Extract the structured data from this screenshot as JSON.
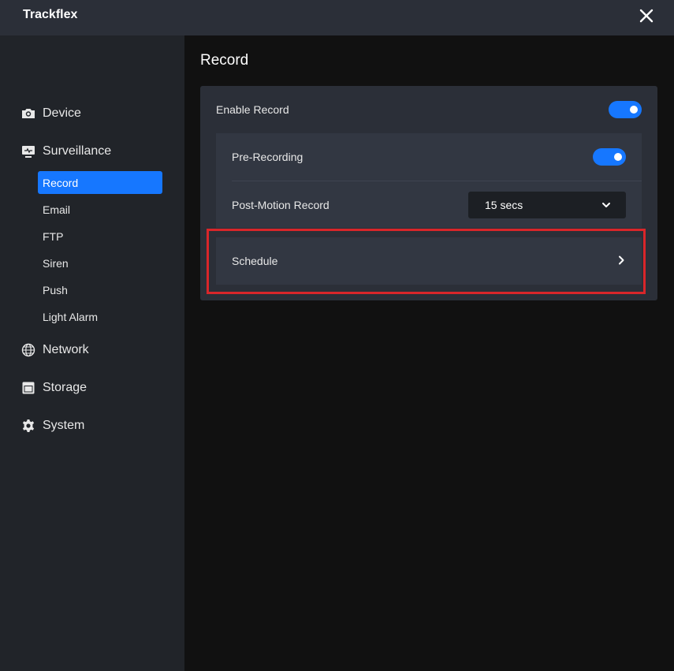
{
  "app": {
    "title": "Trackflex"
  },
  "window": {
    "close_icon": "close-icon"
  },
  "sidebar": {
    "groups": [
      {
        "label": "Device",
        "icon": "camera-icon"
      },
      {
        "label": "Surveillance",
        "icon": "monitor-icon"
      },
      {
        "label": "Network",
        "icon": "globe-icon"
      },
      {
        "label": "Storage",
        "icon": "storage-icon"
      },
      {
        "label": "System",
        "icon": "gear-icon"
      }
    ],
    "surveillance_items": [
      {
        "label": "Record",
        "active": true
      },
      {
        "label": "Email",
        "active": false
      },
      {
        "label": "FTP",
        "active": false
      },
      {
        "label": "Siren",
        "active": false
      },
      {
        "label": "Push",
        "active": false
      },
      {
        "label": "Light Alarm",
        "active": false
      }
    ]
  },
  "main": {
    "title": "Record",
    "enable_record": {
      "label": "Enable Record",
      "on": true
    },
    "pre_recording": {
      "label": "Pre-Recording",
      "on": true
    },
    "post_motion": {
      "label": "Post-Motion Record",
      "value": "15 secs"
    },
    "schedule": {
      "label": "Schedule"
    }
  },
  "colors": {
    "accent": "#1677ff",
    "highlight_border": "#d9262a",
    "sidebar_bg": "#212429",
    "titlebar_bg": "#2b2f38",
    "card_bg": "#2b2f38",
    "inner_bg": "#323742"
  }
}
